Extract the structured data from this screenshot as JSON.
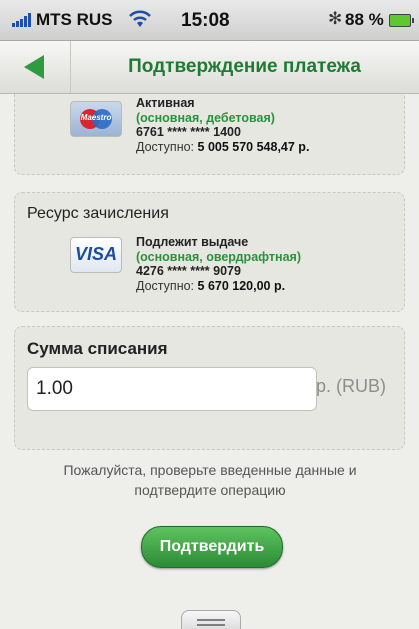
{
  "status_bar": {
    "carrier": "MTS RUS",
    "time": "15:08",
    "bluetooth": "✻",
    "battery": "88 %"
  },
  "nav": {
    "title": "Подтверждение платежа"
  },
  "source_card": {
    "brand": "Maestro",
    "status": "Активная",
    "type": "(основная, дебетовая)",
    "number": "6761 **** **** 1400",
    "available_label": "Доступно:",
    "available_value": "5 005 570 548,47 р."
  },
  "resource": {
    "title": "Ресурс зачисления",
    "brand": "VISA",
    "status": "Подлежит выдаче",
    "type": "(основная, овердрафтная)",
    "number": "4276 **** **** 9079",
    "available_label": "Доступно:",
    "available_value": "5 670 120,00 р."
  },
  "amount": {
    "title": "Сумма списания",
    "value": "1.00",
    "currency": "р. (RUB)"
  },
  "notice": "Пожалуйста, проверьте введенные данные и подтвердите операцию",
  "confirm_label": "Подтвердить",
  "colors": {
    "accent_green": "#2f9a3f",
    "title_green": "#1d7b33"
  }
}
